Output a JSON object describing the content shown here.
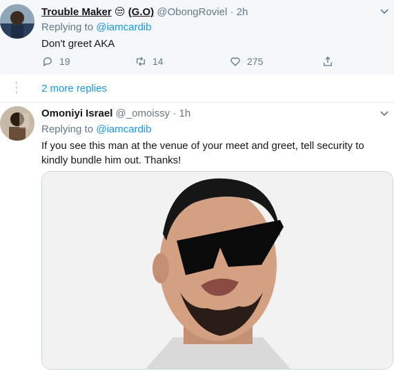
{
  "tweet1": {
    "name": "Trouble Maker",
    "emoji": "😒",
    "name_suffix": "(G.O)",
    "handle": "@ObongRoviel",
    "time": "· 2h",
    "reply_prefix": "Replying to",
    "reply_to": "@iamcardib",
    "text": "Don't greet AKA",
    "replies": "19",
    "retweets": "14",
    "likes": "275"
  },
  "thread": {
    "more_replies": "2 more replies"
  },
  "tweet2": {
    "name": "Omoniyi Israel",
    "handle": "@_omoissy",
    "time": "· 1h",
    "reply_prefix": "Replying to",
    "reply_to": "@iamcardib",
    "text": "If you see this man at the venue of your meet and greet,  tell security to kindly bundle him out. Thanks!"
  },
  "colors": {
    "accent": "#1b95e0",
    "muted": "#657786",
    "highlight_bg": "#f5f8fa"
  }
}
